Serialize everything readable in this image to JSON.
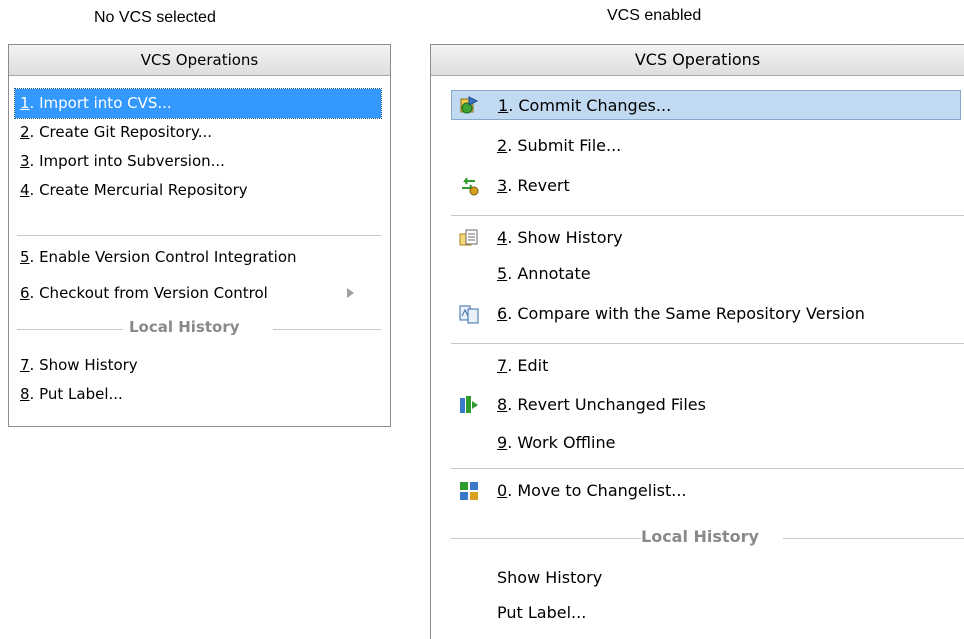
{
  "left": {
    "caption": "No VCS selected",
    "header": "VCS Operations",
    "items": [
      {
        "num": "1",
        "text": ". Import into CVS..."
      },
      {
        "num": "2",
        "text": ". Create Git Repository..."
      },
      {
        "num": "3",
        "text": ". Import into Subversion..."
      },
      {
        "num": "4",
        "text": ". Create Mercurial Repository"
      },
      {
        "num": "5",
        "text": ". Enable Version Control Integration"
      },
      {
        "num": "6",
        "text": ". Checkout from Version Control"
      },
      {
        "num": "7",
        "text": ". Show History"
      },
      {
        "num": "8",
        "text": ". Put Label..."
      }
    ],
    "group_label": "Local History"
  },
  "right": {
    "caption": "VCS enabled",
    "header": "VCS Operations",
    "items": [
      {
        "num": "1",
        "text": ". Commit Changes...",
        "icon": "commit-icon"
      },
      {
        "num": "2",
        "text": ". Submit File..."
      },
      {
        "num": "3",
        "text": ". Revert",
        "icon": "revert-icon"
      },
      {
        "num": "4",
        "text": ". Show History",
        "icon": "history-icon"
      },
      {
        "num": "5",
        "text": ". Annotate"
      },
      {
        "num": "6",
        "text": ". Compare with the Same Repository Version",
        "icon": "compare-icon"
      },
      {
        "num": "7",
        "text": ". Edit"
      },
      {
        "num": "8",
        "text": ". Revert Unchanged Files",
        "icon": "revert-unchanged-icon"
      },
      {
        "num": "9",
        "text": ". Work Offline"
      },
      {
        "num": "0",
        "text": ". Move to Changelist...",
        "icon": "changelist-icon"
      },
      {
        "text": "Show History"
      },
      {
        "text": "Put Label..."
      }
    ],
    "group_label": "Local History"
  },
  "colors": {
    "selection_left": "#3399ff",
    "selection_right": "#c2daf1",
    "group_label": "#8a8a8a"
  }
}
